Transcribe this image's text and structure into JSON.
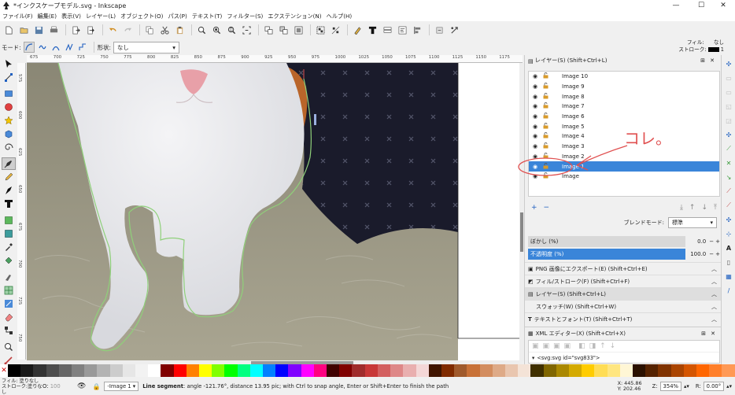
{
  "window": {
    "title": "*インクスケープモデル.svg - Inkscape",
    "controls": [
      "—",
      "☐",
      "✕"
    ]
  },
  "menu": [
    "ファイル(F)",
    "編集(E)",
    "表示(V)",
    "レイヤー(L)",
    "オブジェクト(O)",
    "パス(P)",
    "テキスト(T)",
    "フィルター(S)",
    "エクステンション(N)",
    "ヘルプ(H)"
  ],
  "toolctl": {
    "mode_label": "モード:",
    "shape_label": "形状:",
    "shape_value": "なし"
  },
  "fillstroke": {
    "fill_label": "フィル:",
    "fill_value": "なし",
    "stroke_label": "ストローク:",
    "stroke_width": "1"
  },
  "ruler": {
    "h_ticks": [
      "675",
      "700",
      "725",
      "750",
      "775",
      "800",
      "825",
      "850",
      "875",
      "900",
      "925",
      "950",
      "975",
      "1000",
      "1025",
      "1050",
      "1075",
      "1100",
      "1125",
      "1150",
      "1175"
    ],
    "v_ticks": [
      "575",
      "600",
      "625",
      "650",
      "675",
      "700",
      "725",
      "750"
    ]
  },
  "layers_panel": {
    "title": "レイヤー(S) (Shift+Ctrl+L)",
    "layers": [
      "Image 10",
      "Image 9",
      "Image 8",
      "Image 7",
      "Image 6",
      "Image 5",
      "Image 4",
      "Image 3",
      "Image 2",
      "Image 1",
      "Image"
    ],
    "selected_index": 9,
    "blend_label": "ブレンドモード:",
    "blend_value": "標準",
    "blur_label": "ぼかし (%)",
    "blur_value": "0.0",
    "blur_fraction": 0.0,
    "opacity_label": "不透明度 (%)",
    "opacity_value": "100.0",
    "opacity_fraction": 1.0,
    "annotation": "コレ。"
  },
  "dock_panels": [
    {
      "label": "PNG 画像にエクスポート(E) (Shift+Ctrl+E)",
      "icon": "png-export-icon"
    },
    {
      "label": "フィル/ストローク(F) (Shift+Ctrl+F)",
      "icon": "fill-stroke-icon"
    },
    {
      "label": "レイヤー(S) (Shift+Ctrl+L)",
      "icon": "layers-icon"
    },
    {
      "label": "スウォッチ(W) (Shift+Ctrl+W)",
      "icon": "swatches-icon"
    },
    {
      "label": "テキストとフォント(T) (Shift+Ctrl+T)",
      "icon": "text-font-icon"
    },
    {
      "label": "XML エディター(X) (Shift+Ctrl+X)",
      "icon": "xml-editor-icon"
    }
  ],
  "xml": {
    "node": "<svg:svg id=\"svg833\">"
  },
  "status": {
    "fill_label": "フィル:",
    "fill_value": "塗りなし",
    "stroke_label": "ストローク:",
    "stroke_value": "塗りなし",
    "opacity_label": "O:",
    "opacity_value": "100",
    "layer_value": "-Image 1",
    "message_bold": "Line segment",
    "message_rest": ": angle -121.76°, distance 13.95 pic; with Ctrl to snap angle, Enter or Shift+Enter to finish the path",
    "x_label": "X:",
    "x_value": "445.86",
    "y_label": "Y:",
    "y_value": "202.46",
    "zoom_label": "Z:",
    "zoom_value": "354%",
    "rot_label": "R:",
    "rot_value": "0.00°"
  },
  "colors": {
    "accent": "#3a85d9",
    "annotation": "#e05050",
    "path_outline": "#8fd07a"
  },
  "palette": [
    "#000000",
    "#1a1a1a",
    "#333333",
    "#4d4d4d",
    "#666666",
    "#808080",
    "#999999",
    "#b3b3b3",
    "#cccccc",
    "#e6e6e6",
    "#f2f2f2",
    "#ffffff",
    "#800000",
    "#ff0000",
    "#ff8000",
    "#ffff00",
    "#80ff00",
    "#00ff00",
    "#00ff80",
    "#00ffff",
    "#0080ff",
    "#0000ff",
    "#8000ff",
    "#ff00ff",
    "#ff0080",
    "#400000",
    "#800000",
    "#a02c2c",
    "#c83737",
    "#d35f5f",
    "#de8787",
    "#e9afaf",
    "#f4d7d7",
    "#401500",
    "#802b00",
    "#a05a2c",
    "#c87137",
    "#d38d5f",
    "#deaa87",
    "#e9c6af",
    "#f4e3d7",
    "#403000",
    "#806600",
    "#aa8800",
    "#d4aa00",
    "#ffcc00",
    "#ffdd55",
    "#ffe680",
    "#fff6d5",
    "#2b1100",
    "#552200",
    "#803300",
    "#aa4400",
    "#d45500",
    "#ff6600",
    "#ff7f2a",
    "#ff9955"
  ]
}
